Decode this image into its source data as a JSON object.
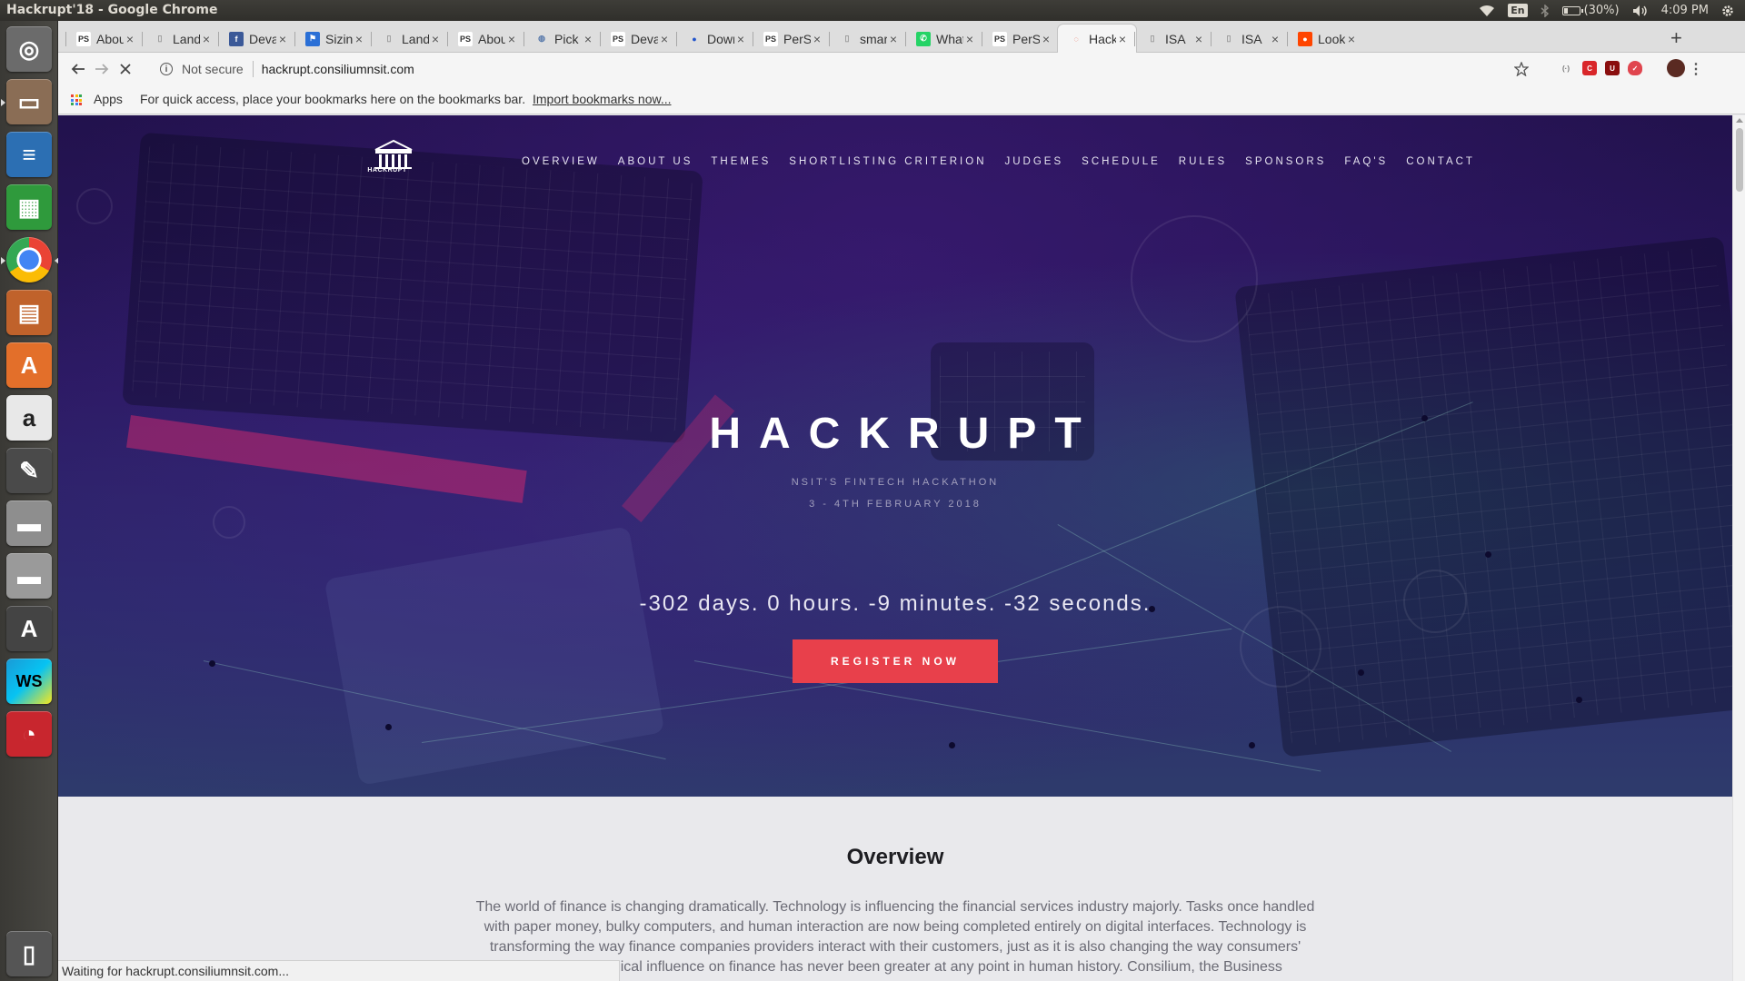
{
  "os": {
    "window_title": "Hackrupt'18 - Google Chrome",
    "lang": "En",
    "battery": "(30%)",
    "battery_level": 0.3,
    "time": "4:09 PM"
  },
  "launcher": [
    {
      "name": "ubuntu-dash",
      "color": "#6b6b6b"
    },
    {
      "name": "files",
      "color": "#8a6d55"
    },
    {
      "name": "libreoffice-writer",
      "color": "#2c6fb3"
    },
    {
      "name": "libreoffice-calc",
      "color": "#2f9a3c"
    },
    {
      "name": "google-chrome",
      "color": "#e0e0e0"
    },
    {
      "name": "libreoffice-impress",
      "color": "#c0622b"
    },
    {
      "name": "ubuntu-software",
      "color": "#e36f2a"
    },
    {
      "name": "amazon",
      "color": "#e8e8e8"
    },
    {
      "name": "system-settings",
      "color": "#4a4a4a"
    },
    {
      "name": "disk-drive",
      "color": "#8e8e8e"
    },
    {
      "name": "disk-drive-2",
      "color": "#9a9a9a"
    },
    {
      "name": "software-updater",
      "color": "#444444"
    },
    {
      "name": "webstorm",
      "color": "#1a9ad6"
    },
    {
      "name": "pdf-viewer",
      "color": "#c8262e"
    },
    {
      "name": "trash",
      "color": "#555555"
    }
  ],
  "tabs": [
    {
      "title": "Abou",
      "favicon": "ps"
    },
    {
      "title": "Landi",
      "favicon": "doc"
    },
    {
      "title": "Deva",
      "favicon": "fb"
    },
    {
      "title": "Sizing",
      "favicon": "flag"
    },
    {
      "title": "Landi",
      "favicon": "doc"
    },
    {
      "title": "Abou",
      "favicon": "ps"
    },
    {
      "title": "Pick a",
      "favicon": "globe"
    },
    {
      "title": "Deva",
      "favicon": "ps"
    },
    {
      "title": "Down",
      "favicon": "person"
    },
    {
      "title": "PerSt",
      "favicon": "ps"
    },
    {
      "title": "smart",
      "favicon": "doc"
    },
    {
      "title": "What",
      "favicon": "whatsapp"
    },
    {
      "title": "PerSt",
      "favicon": "ps"
    },
    {
      "title": "Hackr",
      "favicon": "loading",
      "active": true
    },
    {
      "title": "ISA",
      "favicon": "doc"
    },
    {
      "title": "ISA",
      "favicon": "doc"
    },
    {
      "title": "Look",
      "favicon": "reddit"
    }
  ],
  "toolbar": {
    "security_label": "Not secure",
    "url": "hackrupt.consiliumnsit.com"
  },
  "bookmarks": {
    "apps_label": "Apps",
    "hint": "For quick access, place your bookmarks here on the bookmarks bar.",
    "import_label": "Import bookmarks now..."
  },
  "site": {
    "logo_text": "HACKRUPT",
    "nav": [
      "OVERVIEW",
      "ABOUT US",
      "THEMES",
      "SHORTLISTING CRITERION",
      "JUDGES",
      "SCHEDULE",
      "RULES",
      "SPONSORS",
      "FAQ'S",
      "CONTACT"
    ],
    "hero_title": "HACKRUPT",
    "hero_subtitle": "NSIT'S FINTECH HACKATHON",
    "hero_date": "3 - 4TH FEBRUARY 2018",
    "countdown": "-302 days.  0 hours.  -9 minutes.  -32 seconds.",
    "register_label": "REGISTER NOW",
    "overview_title": "Overview",
    "overview_body": "The world of finance is changing dramatically. Technology is influencing the financial services industry majorly. Tasks once handled with paper money, bulky computers, and human interaction are now being completed entirely on digital interfaces. Technology is transforming the way finance companies providers interact with their customers, just as it is also changing the way consumers' access technological influence on finance has never been greater at any point in human history. Consilium, the Business"
  },
  "status_text": "Waiting for hackrupt.consiliumnsit.com...",
  "colors": {
    "accent": "#e8404b",
    "hero_bg": "#2a1860"
  }
}
